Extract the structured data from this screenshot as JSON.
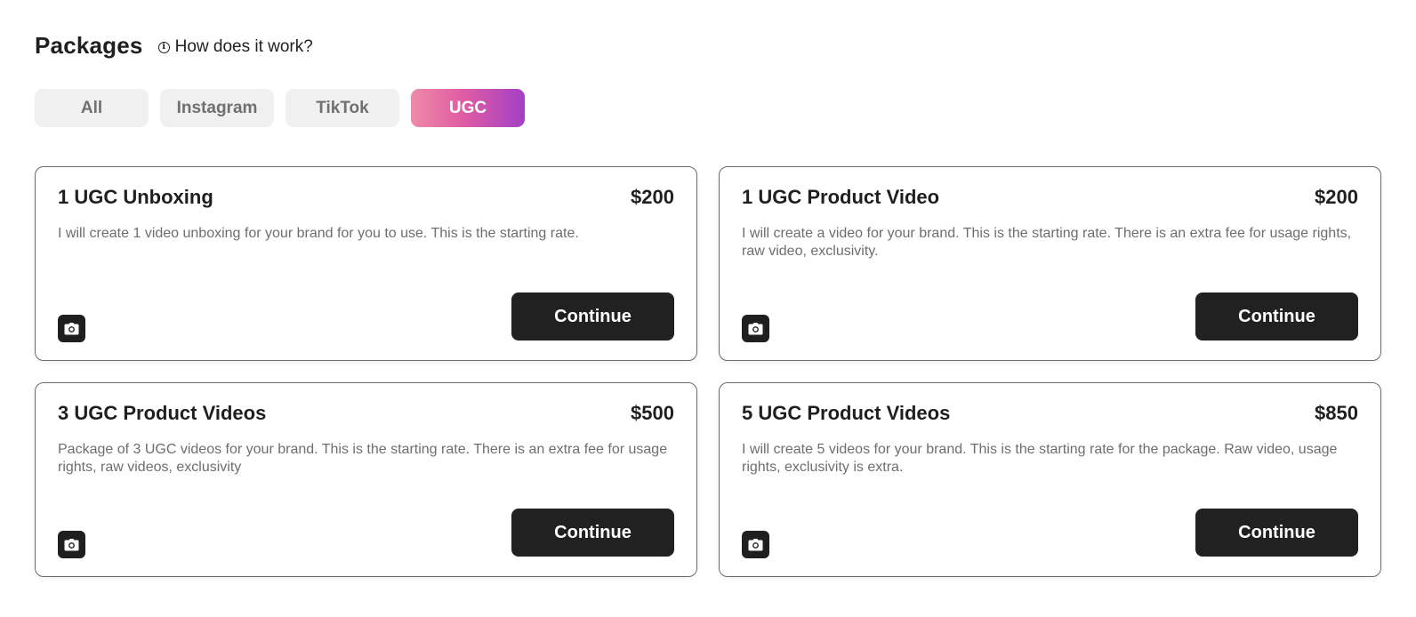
{
  "header": {
    "title": "Packages",
    "help_link": "How does it work?"
  },
  "tabs": [
    {
      "label": "All",
      "active": false
    },
    {
      "label": "Instagram",
      "active": false
    },
    {
      "label": "TikTok",
      "active": false
    },
    {
      "label": "UGC",
      "active": true
    }
  ],
  "packages": [
    {
      "title": "1 UGC Unboxing",
      "price": "$200",
      "description": "I will create 1 video unboxing for your brand for you to use. This is the starting rate.",
      "icon": "camera-icon",
      "button": "Continue"
    },
    {
      "title": "1 UGC Product Video",
      "price": "$200",
      "description": "I will create a video for your brand. This is the starting rate. There is an extra fee for usage rights, raw video, exclusivity.",
      "icon": "camera-icon",
      "button": "Continue"
    },
    {
      "title": "3 UGC Product Videos",
      "price": "$500",
      "description": "Package of 3 UGC videos for your brand. This is the starting rate. There is an extra fee for usage rights, raw videos, exclusivity",
      "icon": "camera-icon",
      "button": "Continue"
    },
    {
      "title": "5 UGC Product Videos",
      "price": "$850",
      "description": "I will create 5 videos for your brand. This is the starting rate for the package. Raw video, usage rights, exclusivity is extra.",
      "icon": "camera-icon",
      "button": "Continue"
    }
  ],
  "colors": {
    "active_tab_gradient_start": "#ee8aa8",
    "active_tab_gradient_end": "#a33fc6",
    "button_bg": "#212121",
    "tab_bg": "#f0f0f0"
  }
}
